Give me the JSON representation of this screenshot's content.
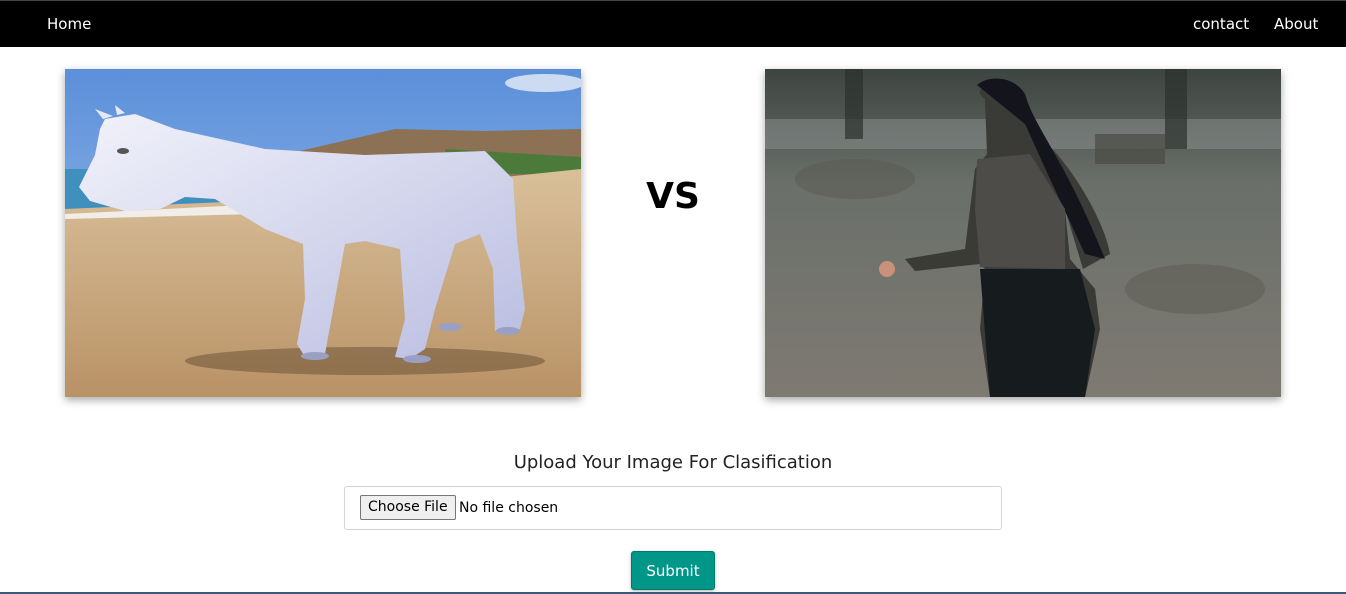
{
  "navbar": {
    "home_label": "Home",
    "contact_label": "contact",
    "about_label": "About"
  },
  "comparison": {
    "left_image_label": "horse-photo",
    "vs_label": "VS",
    "right_image_label": "woman-photo"
  },
  "upload": {
    "title": "Upload Your Image For Clasification",
    "choose_file_label": "Choose File",
    "file_status": "No file chosen",
    "submit_label": "Submit"
  },
  "colors": {
    "navbar_bg": "#000000",
    "submit_bg": "#009688"
  }
}
